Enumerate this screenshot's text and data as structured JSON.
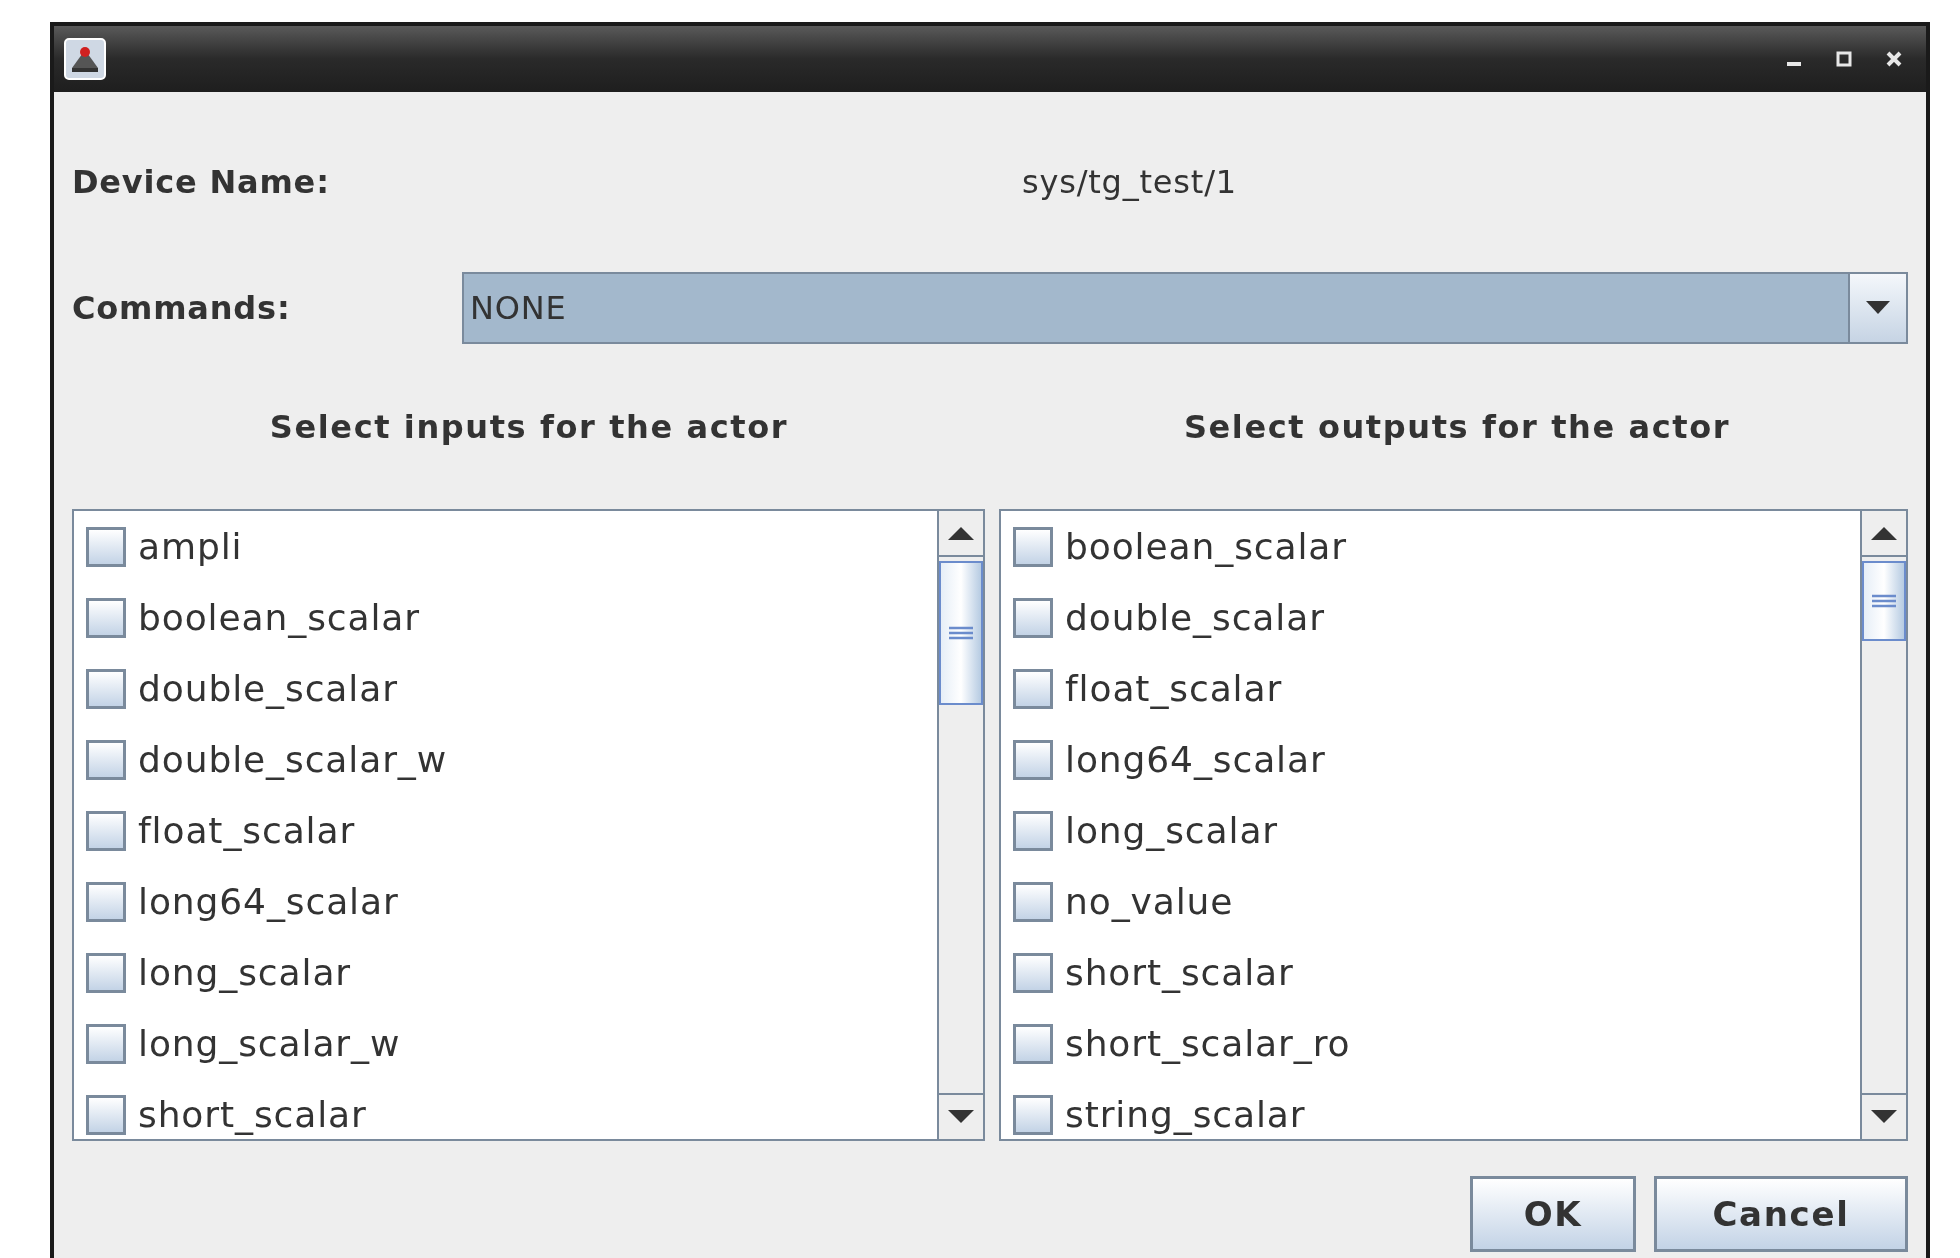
{
  "device_name": {
    "label": "Device Name:",
    "value": "sys/tg_test/1"
  },
  "commands": {
    "label": "Commands:",
    "value": "NONE"
  },
  "inputs": {
    "heading": "Select inputs for the actor",
    "items": [
      {
        "label": "ampli",
        "checked": false
      },
      {
        "label": "boolean_scalar",
        "checked": false
      },
      {
        "label": "double_scalar",
        "checked": false
      },
      {
        "label": "double_scalar_w",
        "checked": false
      },
      {
        "label": "float_scalar",
        "checked": false
      },
      {
        "label": "long64_scalar",
        "checked": false
      },
      {
        "label": "long_scalar",
        "checked": false
      },
      {
        "label": "long_scalar_w",
        "checked": false
      },
      {
        "label": "short_scalar",
        "checked": false
      }
    ]
  },
  "outputs": {
    "heading": "Select outputs for the actor",
    "items": [
      {
        "label": "boolean_scalar",
        "checked": false
      },
      {
        "label": "double_scalar",
        "checked": false
      },
      {
        "label": "float_scalar",
        "checked": false
      },
      {
        "label": "long64_scalar",
        "checked": false
      },
      {
        "label": "long_scalar",
        "checked": false
      },
      {
        "label": "no_value",
        "checked": false
      },
      {
        "label": "short_scalar",
        "checked": false
      },
      {
        "label": "short_scalar_ro",
        "checked": false
      },
      {
        "label": "string_scalar",
        "checked": false
      }
    ]
  },
  "buttons": [
    "OK",
    "Cancel"
  ]
}
